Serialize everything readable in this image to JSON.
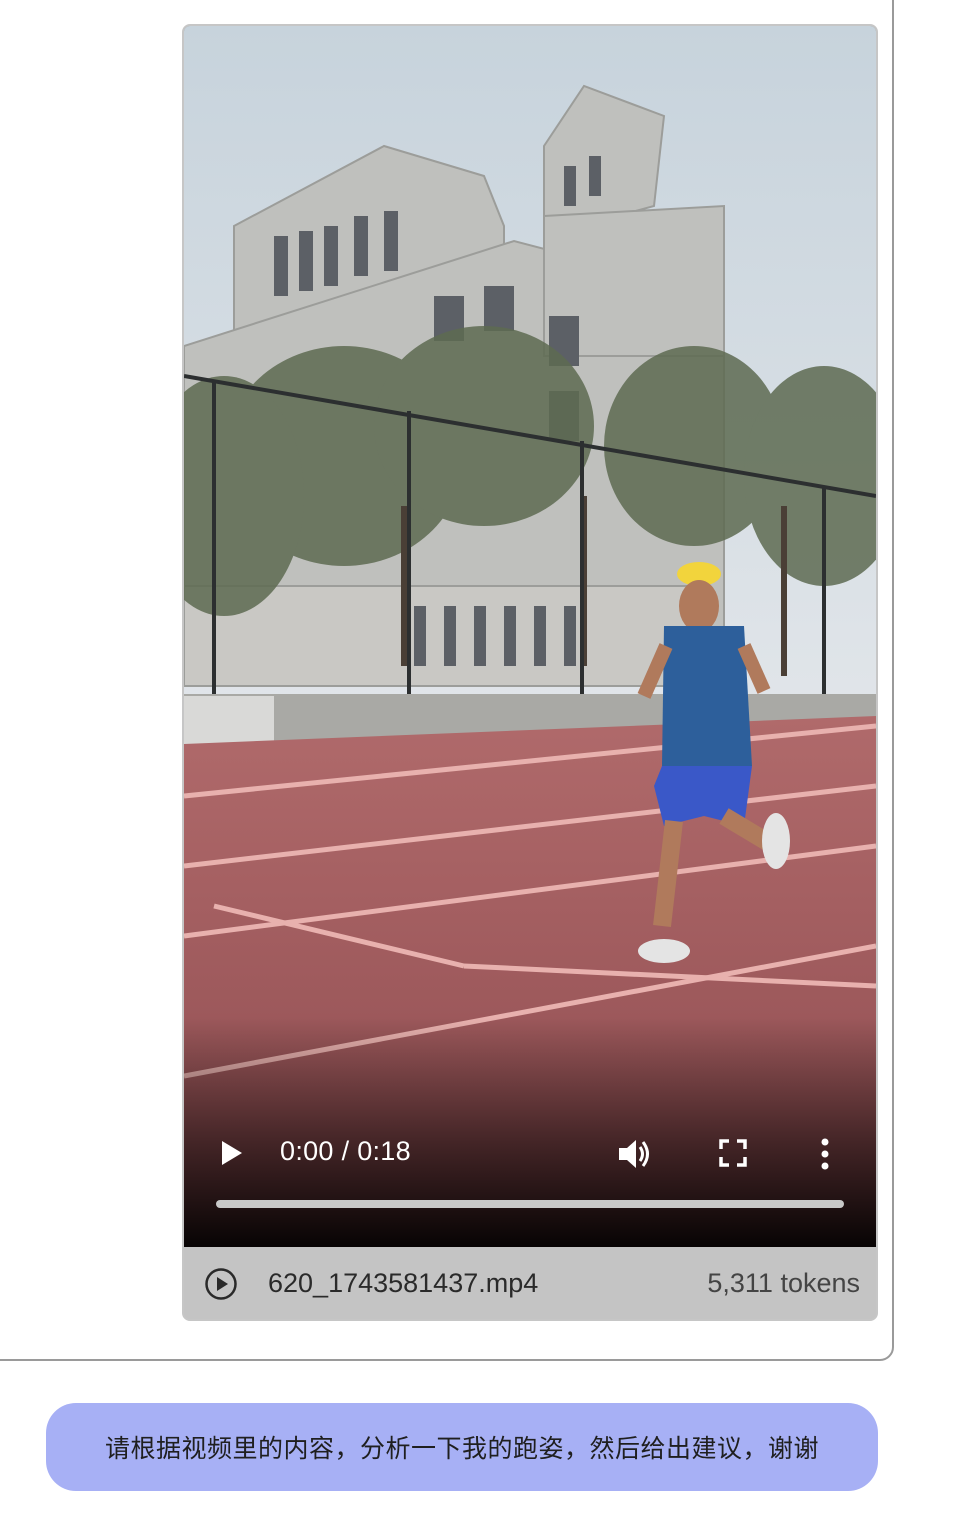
{
  "video": {
    "current_time": "0:00",
    "separator": "/",
    "duration": "0:18",
    "progress_fraction": 0
  },
  "attachment": {
    "file_name": "620_1743581437.mp4",
    "token_count": "5,311 tokens"
  },
  "prompt": {
    "text": "请根据视频里的内容，分析一下我的跑姿，然后给出建议，谢谢"
  },
  "colors": {
    "prompt_bubble": "#a7b0f5",
    "track": "#a85a5e",
    "sky": "#cfd8e0"
  }
}
